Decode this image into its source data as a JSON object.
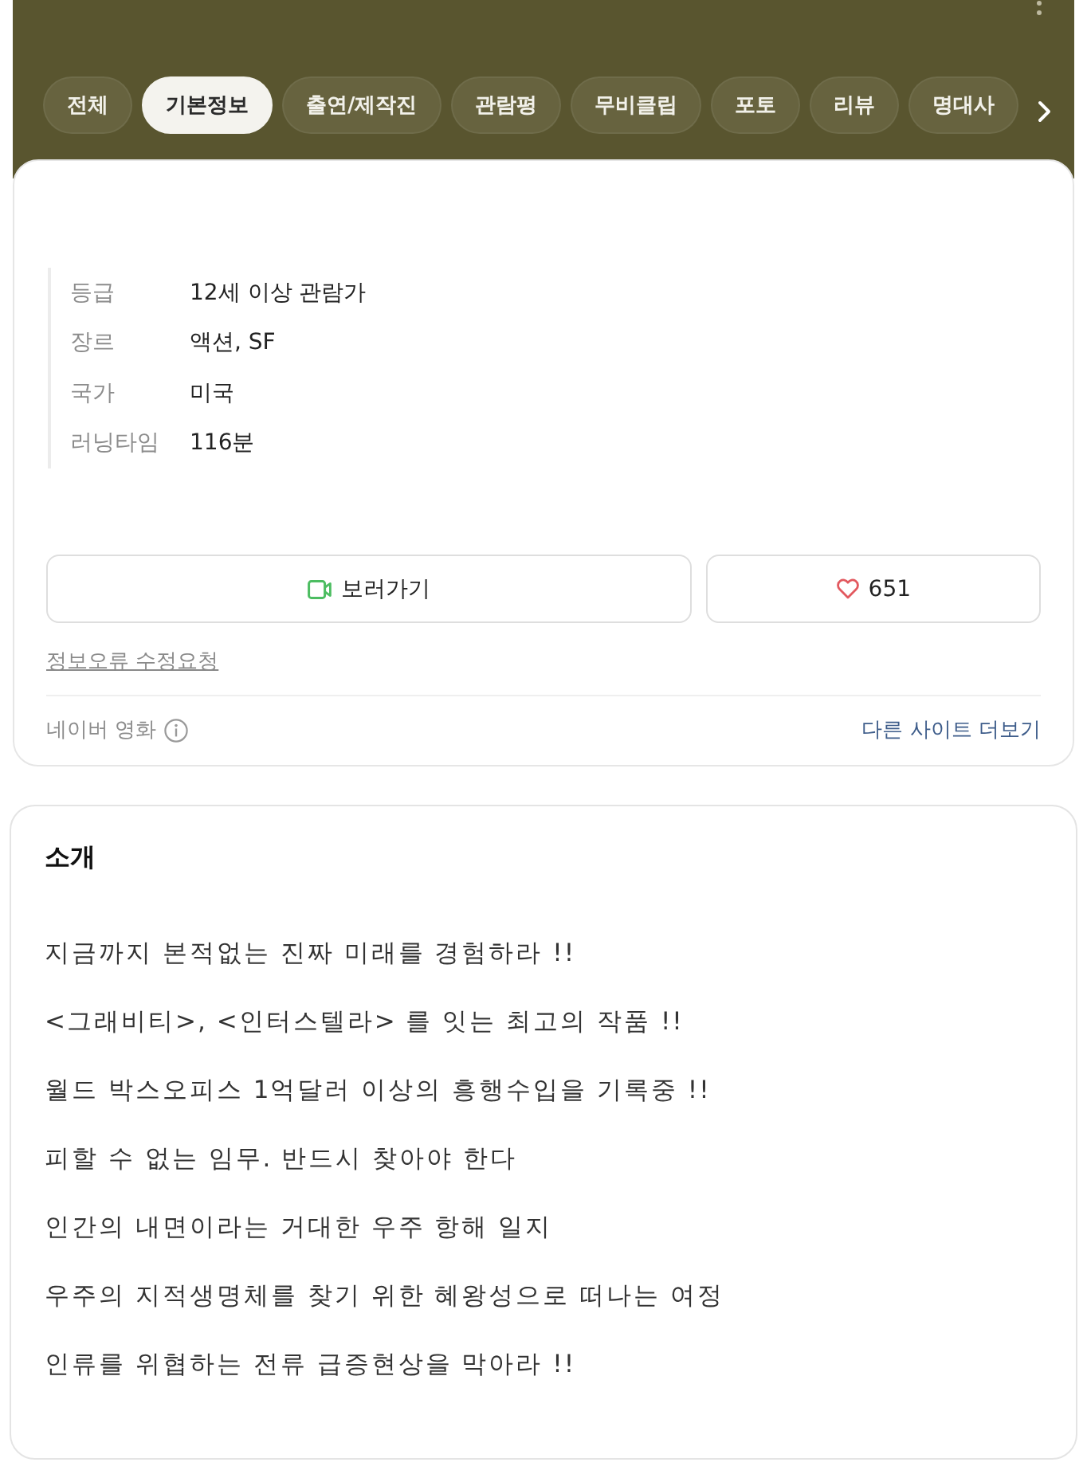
{
  "header": {
    "tabs": [
      {
        "label": "전체",
        "selected": false
      },
      {
        "label": "기본정보",
        "selected": true
      },
      {
        "label": "출연/제작진",
        "selected": false
      },
      {
        "label": "관람평",
        "selected": false
      },
      {
        "label": "무비클립",
        "selected": false
      },
      {
        "label": "포토",
        "selected": false
      },
      {
        "label": "리뷰",
        "selected": false
      },
      {
        "label": "명대사",
        "selected": false
      }
    ]
  },
  "info": {
    "rows": [
      {
        "label": "등급",
        "value": "12세 이상 관람가"
      },
      {
        "label": "장르",
        "value": "액션, SF"
      },
      {
        "label": "국가",
        "value": "미국"
      },
      {
        "label": "러닝타임",
        "value": "116분"
      }
    ],
    "watch_button": {
      "label": "보러가기"
    },
    "like_button": {
      "count": "651"
    },
    "report_link": "정보오류 수정요청",
    "source": "네이버 영화",
    "more_sites_link": "다른 사이트 더보기"
  },
  "intro": {
    "title": "소개",
    "lines": [
      "지금까지 본적없는 진짜 미래를 경험하라 !!",
      "<그래비티>, <인터스텔라> 를 잇는 최고의 작품 !!",
      "월드 박스오피스 1억달러 이상의 흥행수입을 기록중 !!",
      "피할 수 없는 임무. 반드시 찾아야 한다",
      "인간의 내면이라는 거대한 우주 항해 일지",
      "우주의 지적생명체를 찾기 위한 혜왕성으로 떠나는 여정",
      "인류를 위협하는 전류 급증현상을 막아라 !!"
    ]
  }
}
